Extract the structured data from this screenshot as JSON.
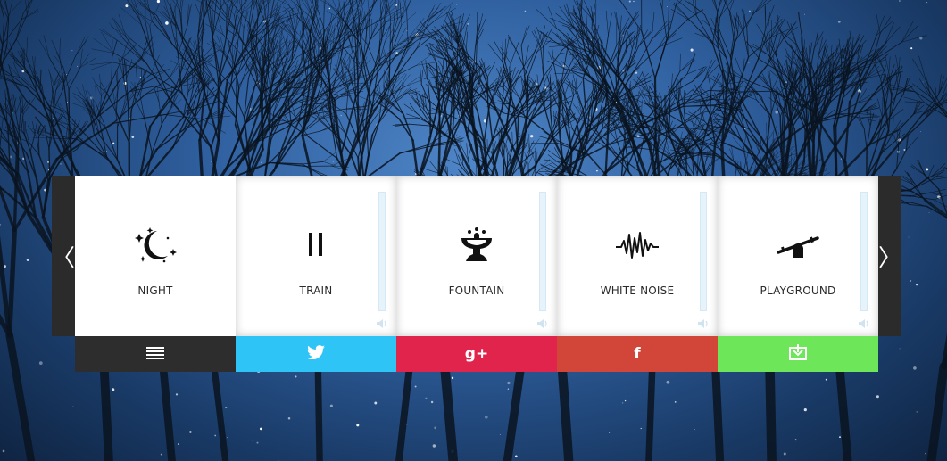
{
  "nav": {
    "prev_glyph": "〈",
    "next_glyph": "〉"
  },
  "tiles": [
    {
      "label": "NIGHT",
      "icon": "moon-stars-icon",
      "active": true
    },
    {
      "label": "TRAIN",
      "icon": "pause-icon",
      "active": false
    },
    {
      "label": "FOUNTAIN",
      "icon": "fountain-icon",
      "active": false
    },
    {
      "label": "WHITE NOISE",
      "icon": "waveform-icon",
      "active": false
    },
    {
      "label": "PLAYGROUND",
      "icon": "seesaw-icon",
      "active": false
    }
  ],
  "bottom_bar": [
    {
      "name": "menu",
      "icon": "menu-icon",
      "color": "#2d2d2d"
    },
    {
      "name": "twitter",
      "icon": "twitter-icon",
      "color": "#2ec4f5"
    },
    {
      "name": "google-plus",
      "icon": "google-plus-icon",
      "glyph": "g+",
      "color": "#e0244c"
    },
    {
      "name": "facebook",
      "icon": "facebook-icon",
      "glyph": "f",
      "color": "#d2463a"
    },
    {
      "name": "download",
      "icon": "download-icon",
      "color": "#6ee65a"
    }
  ],
  "colors": {
    "tile_bg": "#ffffff",
    "arrow_bg": "#2b2b2b",
    "slider_track": "#e7f3fb",
    "icon_color": "#111111"
  }
}
